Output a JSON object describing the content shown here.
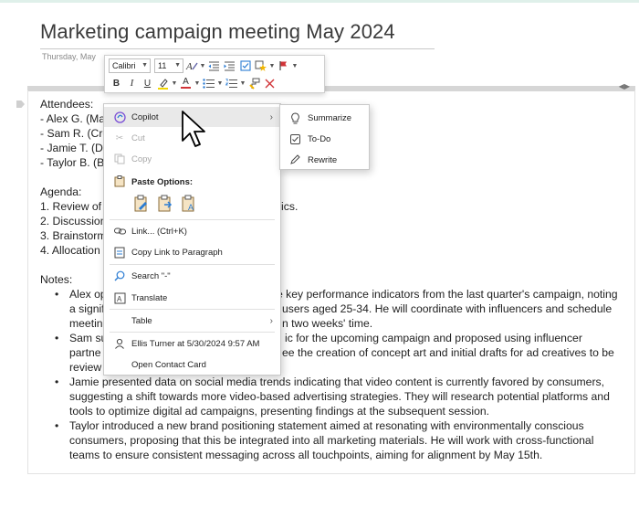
{
  "page": {
    "title": "Marketing campaign meeting May 2024",
    "date": "Thursday, May"
  },
  "toolbar": {
    "font_name": "Calibri",
    "font_size": "11",
    "bold": "B",
    "italic": "I",
    "underline": "U",
    "font_color_glyph": "A"
  },
  "note": {
    "attendees_heading": "Attendees:",
    "attendees": [
      "- Alex G. (Ma",
      "- Sam R. (Cre",
      "- Jamie T. (Di",
      "- Taylor B. (Br"
    ],
    "agenda_heading": "Agenda:",
    "agenda": [
      {
        "left": "1. Review of",
        "right": "rics."
      },
      {
        "left": "2. Discussion",
        "right": ""
      },
      {
        "left": "3. Brainstorm",
        "right": ""
      },
      {
        "left": "4. Allocation",
        "right": ""
      }
    ],
    "notes_heading": "Notes:",
    "notes": [
      {
        "lines": [
          {
            "left": "Alex op",
            "right": "e key performance indicators from the last quarter's campaign, noting"
          },
          {
            "left": "a signif",
            "right": "users aged 25-34. He will coordinate with influencers and schedule"
          },
          {
            "left": "meetin",
            "right": "n two weeks' time."
          }
        ]
      },
      {
        "lines": [
          {
            "left": "Sam su",
            "right": "ic for the upcoming campaign and proposed using influencer"
          },
          {
            "left": "partne",
            "right": "ee the creation of concept art and initial drafts for ad creatives to be"
          },
          {
            "left": "review",
            "right": ""
          }
        ]
      },
      {
        "lines": [
          {
            "left": "Jamie presented data on social media trends indicating that video content is currently favored by consumers,",
            "right": ""
          },
          {
            "left": "suggesting a shift towards more video-based advertising strategies. They will research potential platforms and",
            "right": ""
          },
          {
            "left": "tools to optimize digital ad campaigns, presenting findings at the subsequent session.",
            "right": ""
          }
        ]
      },
      {
        "lines": [
          {
            "left": "Taylor introduced a new brand positioning statement aimed at resonating with environmentally conscious",
            "right": ""
          },
          {
            "left": "consumers, proposing that this be integrated into all marketing materials. He will work with cross-functional",
            "right": ""
          },
          {
            "left": "teams to ensure consistent messaging across all touchpoints, aiming for alignment by May 15th.",
            "right": ""
          }
        ]
      }
    ]
  },
  "context_menu": {
    "copilot": "Copilot",
    "cut": "Cut",
    "copy": "Copy",
    "paste_options": "Paste Options:",
    "link": "Link...  (Ctrl+K)",
    "copy_link": "Copy Link to Paragraph",
    "search": "Search \"-\"",
    "translate": "Translate",
    "table": "Table",
    "author": "Ellis Turner at 5/30/2024 9:57 AM",
    "open_contact": "Open Contact Card"
  },
  "copilot_submenu": {
    "summarize": "Summarize",
    "todo": "To-Do",
    "rewrite": "Rewrite"
  },
  "colors": {
    "highlight": "#f2d600",
    "font_color": "#d13438",
    "copilot_purple": "#7b4fd6",
    "paste_blue": "#2b7cd3",
    "flag_red": "#d13438"
  }
}
